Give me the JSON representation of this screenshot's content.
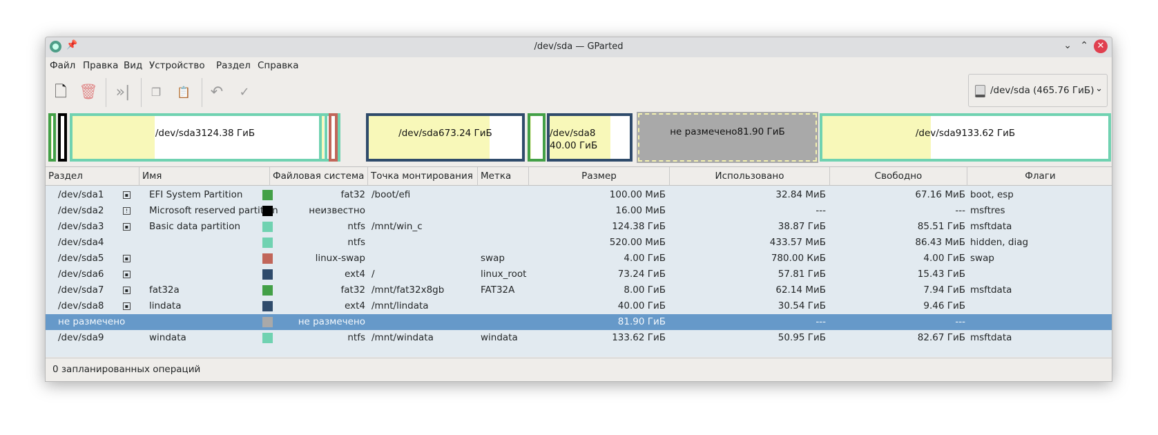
{
  "window": {
    "title": "/dev/sda — GParted"
  },
  "menu": [
    "Файл",
    "Правка",
    "Вид",
    "Устройство",
    "Раздел",
    "Справка"
  ],
  "device_selector": "/dev/sda (465.76 ГиБ)",
  "map": [
    {
      "name": "/dev/sda1",
      "color": "#43a047",
      "used": 0.33
    },
    {
      "name": "/dev/sda2",
      "color": "#000000",
      "used": 0
    },
    {
      "name": "/dev/sda3",
      "size": "124.38 ГиБ",
      "color": "#70d2b1",
      "used": 0.31
    },
    {
      "name": "/dev/sda4",
      "color": "#70d2b1",
      "used": 0.83
    },
    {
      "name": "/dev/sda5",
      "color": "#c1665a",
      "used": 0
    },
    {
      "name": "/dev/sda6",
      "size": "73.24 ГиБ",
      "color": "#2f4b6b",
      "used": 0.79
    },
    {
      "name": "/dev/sda7",
      "color": "#43a047",
      "used": 0.01
    },
    {
      "name": "/dev/sda8",
      "size": "40.00 ГиБ",
      "color": "#2f4b6b",
      "used": 0.76
    },
    {
      "name": "не размечено",
      "size": "81.90 ГиБ",
      "color": "#a9a9a9",
      "used": 0
    },
    {
      "name": "/dev/sda9",
      "size": "133.62 ГиБ",
      "color": "#70d2b1",
      "used": 0.38
    }
  ],
  "columns": [
    "Раздел",
    "Имя",
    "Файловая система",
    "Точка монтирования",
    "Метка",
    "Размер",
    "Использовано",
    "Свободно",
    "Флаги"
  ],
  "rows": [
    {
      "part": "/dev/sda1",
      "icon": "lock",
      "name": "EFI System Partition",
      "color": "#43a047",
      "fs": "fat32",
      "mount": "/boot/efi",
      "label": "",
      "size": "100.00 МиБ",
      "used": "32.84 МиБ",
      "free": "67.16 МиБ",
      "flags": "boot, esp"
    },
    {
      "part": "/dev/sda2",
      "icon": "warning",
      "name": "Microsoft reserved partition",
      "color": "#000000",
      "fs": "неизвестно",
      "mount": "",
      "label": "",
      "size": "16.00 МиБ",
      "used": "---",
      "free": "---",
      "flags": "msftres"
    },
    {
      "part": "/dev/sda3",
      "icon": "lock",
      "name": "Basic data partition",
      "color": "#70d2b1",
      "fs": "ntfs",
      "mount": "/mnt/win_c",
      "label": "",
      "size": "124.38 ГиБ",
      "used": "38.87 ГиБ",
      "free": "85.51 ГиБ",
      "flags": "msftdata"
    },
    {
      "part": "/dev/sda4",
      "icon": "",
      "name": "",
      "color": "#70d2b1",
      "fs": "ntfs",
      "mount": "",
      "label": "",
      "size": "520.00 МиБ",
      "used": "433.57 МиБ",
      "free": "86.43 МиБ",
      "flags": "hidden, diag"
    },
    {
      "part": "/dev/sda5",
      "icon": "lock",
      "name": "",
      "color": "#c1665a",
      "fs": "linux-swap",
      "mount": "",
      "label": "swap",
      "size": "4.00 ГиБ",
      "used": "780.00 КиБ",
      "free": "4.00 ГиБ",
      "flags": "swap"
    },
    {
      "part": "/dev/sda6",
      "icon": "lock",
      "name": "",
      "color": "#2f4b6b",
      "fs": "ext4",
      "mount": "/",
      "label": "linux_root",
      "size": "73.24 ГиБ",
      "used": "57.81 ГиБ",
      "free": "15.43 ГиБ",
      "flags": ""
    },
    {
      "part": "/dev/sda7",
      "icon": "lock",
      "name": "fat32a",
      "color": "#43a047",
      "fs": "fat32",
      "mount": "/mnt/fat32x8gb",
      "label": "FAT32A",
      "size": "8.00 ГиБ",
      "used": "62.14 МиБ",
      "free": "7.94 ГиБ",
      "flags": "msftdata"
    },
    {
      "part": "/dev/sda8",
      "icon": "lock",
      "name": "lindata",
      "color": "#2f4b6b",
      "fs": "ext4",
      "mount": "/mnt/lindata",
      "label": "",
      "size": "40.00 ГиБ",
      "used": "30.54 ГиБ",
      "free": "9.46 ГиБ",
      "flags": ""
    },
    {
      "part": "не размечено",
      "icon": "",
      "name": "",
      "color": "#a9a9a9",
      "fs": "не размечено",
      "mount": "",
      "label": "",
      "size": "81.90 ГиБ",
      "used": "---",
      "free": "---",
      "flags": "",
      "selected": true
    },
    {
      "part": "/dev/sda9",
      "icon": "",
      "name": "windata",
      "color": "#70d2b1",
      "fs": "ntfs",
      "mount": "/mnt/windata",
      "label": "windata",
      "size": "133.62 ГиБ",
      "used": "50.95 ГиБ",
      "free": "82.67 ГиБ",
      "flags": "msftdata"
    }
  ],
  "status": "0 запланированных операций"
}
